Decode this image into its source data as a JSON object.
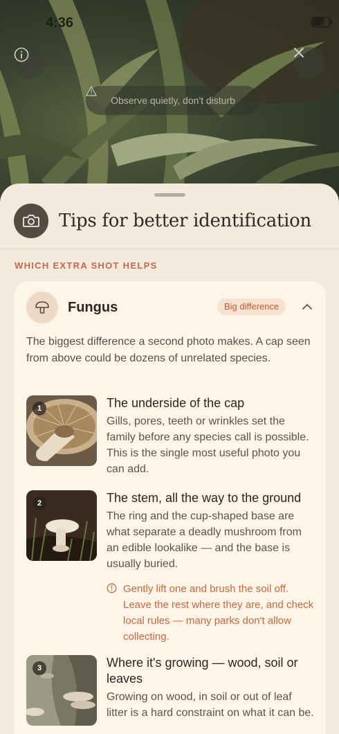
{
  "status_bar": {
    "time": "4:36"
  },
  "camera": {
    "warning": "Observe quietly, don't disturb"
  },
  "sheet": {
    "title": "Tips for better identification",
    "section_label": "WHICH EXTRA SHOT HELPS",
    "card": {
      "name": "Fungus",
      "badge": "Big difference",
      "description": "The biggest difference a second photo makes. A cap seen from above could be dozens of unrelated species.",
      "items": [
        {
          "number": "1",
          "title": "The underside of the cap",
          "body": "Gills, pores, teeth or wrinkles set the family before any species call is possible. This is the single most useful photo you can add."
        },
        {
          "number": "2",
          "title": "The stem, all the way to the ground",
          "body": "The ring and the cup-shaped base are what separate a deadly mushroom from an edible lookalike — and the base is usually buried.",
          "note": "Gently lift one and brush the soil off. Leave the rest where they are, and check local rules — many parks don't allow collecting."
        },
        {
          "number": "3",
          "title": "Where it's growing — wood, soil or leaves",
          "body": "Growing on wood, in soil or out of leaf litter is a hard constraint on what it can be."
        }
      ]
    }
  },
  "icons": {
    "info": "info-icon",
    "close": "close-icon",
    "warning": "warning-icon",
    "camera": "camera-icon",
    "mushroom": "mushroom-icon",
    "chevron": "chevron-up-icon",
    "note": "alert-circle-icon"
  },
  "colors": {
    "sheet_bg": "#f3e9dd",
    "card_bg": "#fdf5e8",
    "accent": "#c26a4a",
    "badge_bg": "#f7e1cf"
  }
}
